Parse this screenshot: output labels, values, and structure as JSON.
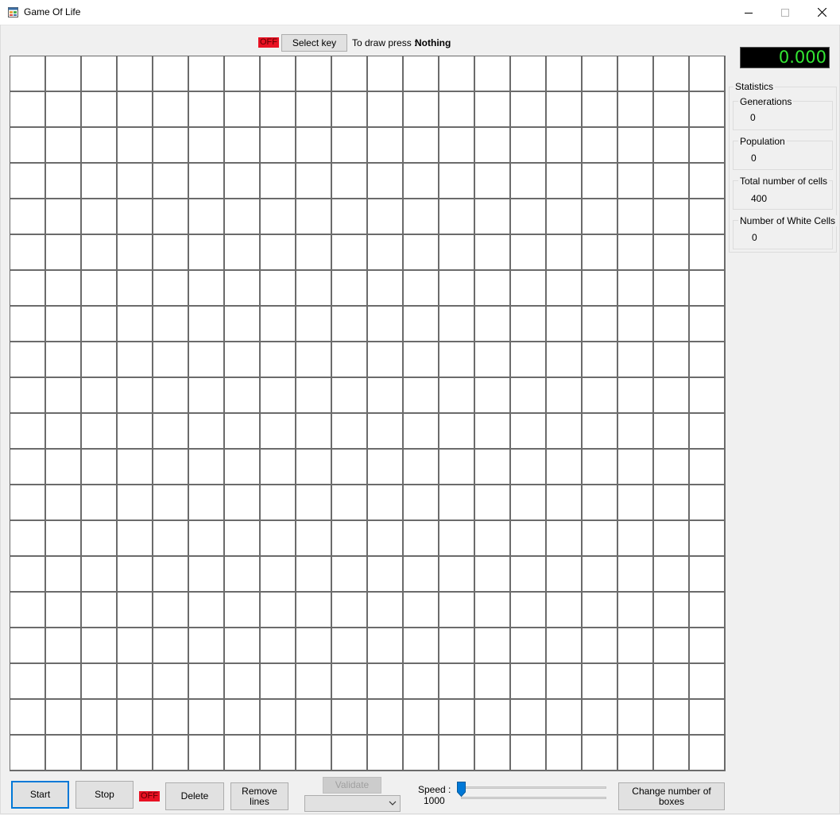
{
  "window": {
    "title": "Game Of Life",
    "icon": "app-window-icon",
    "controls": [
      "minimize-icon",
      "maximize-icon",
      "close-icon"
    ]
  },
  "toolbar": {
    "draw_toggle_status": "OFF",
    "select_key_label": "Select key",
    "draw_prompt_label": "To draw press :",
    "draw_key_value": "Nothing"
  },
  "grid": {
    "rows": 20,
    "columns": 20,
    "alive_cells": 0
  },
  "timer": {
    "value": "0.000",
    "color": "#33e633"
  },
  "statistics": {
    "title": "Statistics",
    "generations_label": "Generations",
    "generations_value": "0",
    "population_label": "Population",
    "population_value": "0",
    "total_cells_label": "Total number of cells",
    "total_cells_value": "400",
    "white_cells_label": "Number of White Cells",
    "white_cells_value": "0"
  },
  "bottom": {
    "start_label": "Start",
    "stop_label": "Stop",
    "delete_toggle_status": "OFF",
    "delete_label": "Delete",
    "remove_lines_line1": "Remove",
    "remove_lines_line2": "lines",
    "validate_label": "Validate",
    "pattern_select_value": "",
    "speed_label": "Speed :",
    "speed_value": "1000",
    "change_boxes_label": "Change number of boxes"
  },
  "colors": {
    "off_badge": "#e81123",
    "primary_border": "#0078d7",
    "grid_line": "#6b6b6b",
    "cell_dead": "#ffffff"
  }
}
